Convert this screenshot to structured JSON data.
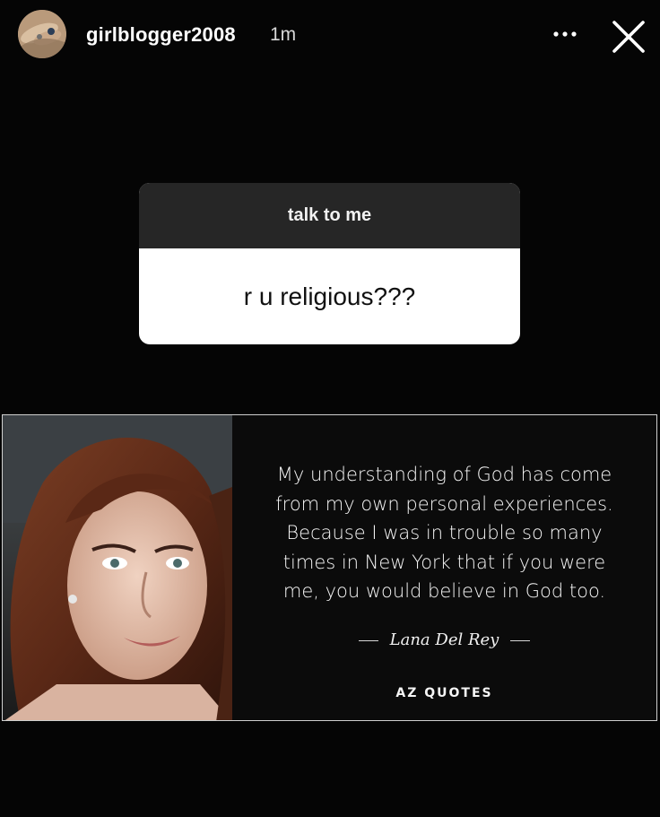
{
  "header": {
    "username": "girlblogger2008",
    "time_ago": "1m",
    "more_icon": "more-dots-icon",
    "close_icon": "close-icon"
  },
  "question": {
    "prompt": "talk to me",
    "text": "r u religious???"
  },
  "quote": {
    "lines": [
      "My understanding of God has come",
      "from my own personal experiences.",
      "Because I was in trouble so many",
      "times in New York that if you were",
      "me, you would believe in God too."
    ],
    "author": "Lana Del Rey",
    "brand": "AZ QUOTES"
  }
}
